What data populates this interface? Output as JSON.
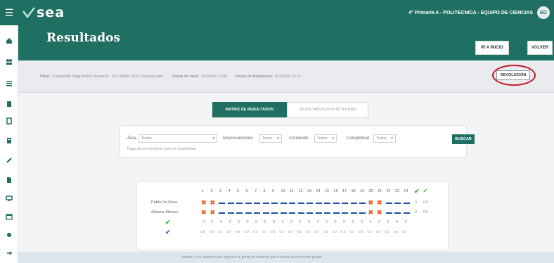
{
  "app": {
    "brand": "sea",
    "course": "4° Primaria A - POLITECNICA - EQUIPO DE CIENCIAS",
    "avatar_initials": "ED"
  },
  "header": {
    "title": "Resultados",
    "buttons": {
      "inicio": "IR A INICIO",
      "volver": "VOLVER"
    }
  },
  "info": {
    "titulo_label": "Título:",
    "titulo_value": "Evaluación diagnóstica Números - 4.0. Medio 2022 Ciencias Aps.",
    "fecha_inicio_label": "Fecha de inicio:",
    "fecha_inicio_value": "07/03/24 12:50",
    "fecha_eval_label": "Fecha de finalización:",
    "fecha_eval_value": "07/03/24 13:15",
    "devolucion": "DEVOLUCIÓN"
  },
  "tabs": [
    {
      "label": "MATRIZ DE RESULTADOS",
      "active": true
    },
    {
      "label": "RESULTADOS POR ACTIVIDAD",
      "active": false
    }
  ],
  "filters": {
    "area_label": "Área",
    "area_value": "Todos",
    "macro_label": "Macrocontenido",
    "macro_value": "Todos",
    "contenido_label": "Contenido",
    "contenido_value": "Todos",
    "completitud_label": "Completitud",
    "completitud_value": "Todos",
    "hint": "Haga clic en el número para ver la actividad",
    "buscar": "BUSCAR"
  },
  "matrix": {
    "columns": [
      "1",
      "2",
      "3",
      "4",
      "5",
      "6",
      "7",
      "8",
      "9",
      "10",
      "11",
      "12",
      "13",
      "14",
      "15",
      "16",
      "17",
      "18",
      "19",
      "20",
      "21",
      "22",
      "23",
      "24"
    ],
    "students": [
      {
        "name": "Pablo Da Rosa",
        "marks": [
          "x",
          "x",
          "-",
          "-",
          "-",
          "-",
          "-",
          "-",
          "-",
          "-",
          "-",
          "-",
          "-",
          "-",
          "-",
          "-",
          "-",
          "-",
          "-",
          "x",
          "x",
          "-",
          "-",
          "-"
        ],
        "correct": "0",
        "pct": "0.0"
      },
      {
        "name": "Adriana Mereau",
        "marks": [
          "x",
          "x",
          "-",
          "-",
          "-",
          "-",
          "-",
          "-",
          "-",
          "-",
          "-",
          "-",
          "-",
          "-",
          "-",
          "-",
          "-",
          "-",
          "-",
          "x",
          "x",
          "-",
          "-",
          "-"
        ],
        "correct": "0",
        "pct": "0.0"
      }
    ],
    "row_correct": [
      "0",
      "0",
      "0",
      "0",
      "0",
      "0",
      "0",
      "0",
      "0",
      "0",
      "0",
      "0",
      "0",
      "0",
      "0",
      "0",
      "0",
      "0",
      "0",
      "0",
      "0",
      "0",
      "0",
      "0"
    ],
    "row_pct": [
      "0.0",
      "0.0",
      "0.0",
      "0.0",
      "0.0",
      "0.0",
      "0.0",
      "0.0",
      "0.0",
      "0.0",
      "0.0",
      "0.0",
      "0.0",
      "0.0",
      "0.0",
      "0.0",
      "0.0",
      "0.0",
      "0.0",
      "0.0",
      "0.0",
      "0.0",
      "0.0",
      "0.0"
    ]
  },
  "bottom": {
    "text": "Indique a los alumnos que ingresen al portal de alumnos para realizar la corrección grupal"
  },
  "colors": {
    "brand": "#1f6f62",
    "error": "#e8692b",
    "highlight": "#c0162b",
    "check": "#3aa845",
    "check2": "#8a3fc4"
  }
}
